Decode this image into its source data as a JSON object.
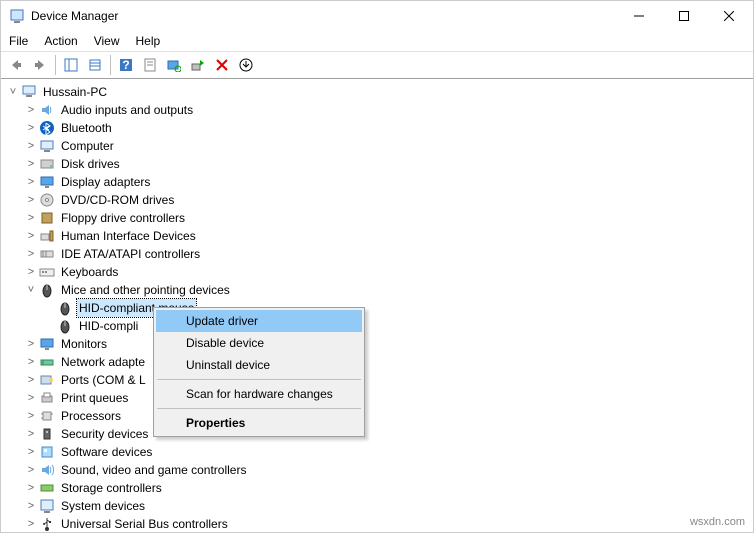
{
  "window": {
    "title": "Device Manager"
  },
  "menu": {
    "file": "File",
    "action": "Action",
    "view": "View",
    "help": "Help"
  },
  "tree": {
    "root": "Hussain-PC",
    "n0": "Audio inputs and outputs",
    "n1": "Bluetooth",
    "n2": "Computer",
    "n3": "Disk drives",
    "n4": "Display adapters",
    "n5": "DVD/CD-ROM drives",
    "n6": "Floppy drive controllers",
    "n7": "Human Interface Devices",
    "n8": "IDE ATA/ATAPI controllers",
    "n9": "Keyboards",
    "n10": "Mice and other pointing devices",
    "n10a": "HID-compliant mouse",
    "n10b": "HID-compli",
    "n11": "Monitors",
    "n12": "Network adapte",
    "n13": "Ports (COM & L",
    "n14": "Print queues",
    "n15": "Processors",
    "n16": "Security devices",
    "n17": "Software devices",
    "n18": "Sound, video and game controllers",
    "n19": "Storage controllers",
    "n20": "System devices",
    "n21": "Universal Serial Bus controllers"
  },
  "context": {
    "update": "Update driver",
    "disable": "Disable device",
    "uninstall": "Uninstall device",
    "scan": "Scan for hardware changes",
    "properties": "Properties"
  },
  "watermark": "wsxdn.com"
}
